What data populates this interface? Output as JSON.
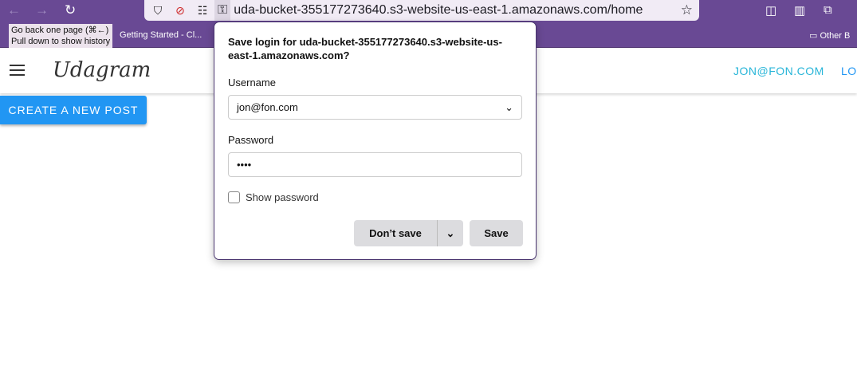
{
  "browser": {
    "url": "uda-bucket-355177273640.s3-website-us-east-1.amazonaws.com/home",
    "tooltip_line1": "Go back one page (⌘←)",
    "tooltip_line2": "Pull down to show history",
    "bookmark1": "Getting Started - Cl...",
    "other_bookmarks": "Other B",
    "accent": "#694994"
  },
  "app": {
    "logo": "Udagram",
    "user": "JON@FON.COM",
    "logout": "LO",
    "create_post": "CREATE A NEW POST"
  },
  "dialog": {
    "title": "Save login for uda-bucket-355177273640.s3-website-us-east-1.amazonaws.com?",
    "username_label": "Username",
    "username_value": "jon@fon.com",
    "password_label": "Password",
    "password_value": "••••",
    "show_password": "Show password",
    "dont_save": "Don’t save",
    "save": "Save"
  }
}
